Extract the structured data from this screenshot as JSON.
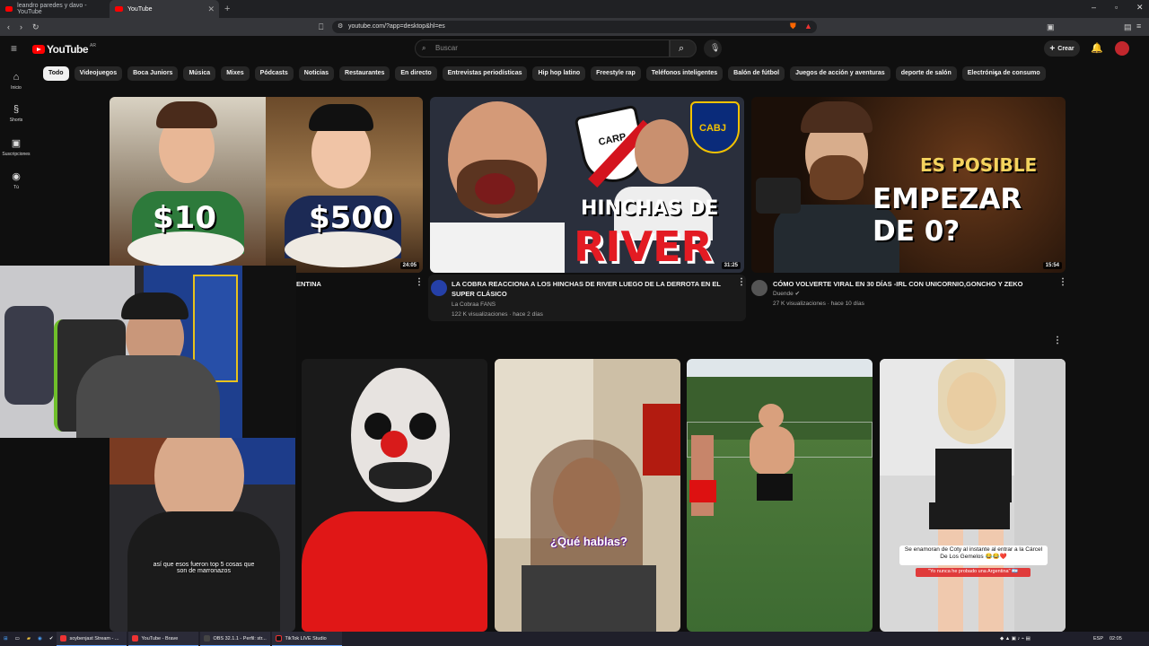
{
  "browser": {
    "tabs": [
      {
        "title": "leandro paredes y davo - YouTube"
      },
      {
        "title": "YouTube"
      }
    ],
    "url": "youtube.com/?app=desktop&hl=es"
  },
  "header": {
    "logo_text": "YouTube",
    "region": "AR",
    "search_placeholder": "Buscar",
    "create_label": "Crear"
  },
  "sidebar": {
    "items": [
      {
        "label": "Inicio",
        "icon": "home-icon"
      },
      {
        "label": "Shorts",
        "icon": "shorts-icon"
      },
      {
        "label": "Suscripciones",
        "icon": "subscriptions-icon"
      },
      {
        "label": "Tú",
        "icon": "you-icon"
      }
    ]
  },
  "chips": [
    "Todo",
    "Videojuegos",
    "Boca Juniors",
    "Música",
    "Mixes",
    "Pódcasts",
    "Noticias",
    "Restaurantes",
    "En directo",
    "Entrevistas periodísticas",
    "Hip hop latino",
    "Freestyle rap",
    "Teléfonos inteligentes",
    "Balón de fútbol",
    "Juegos de acción y aventuras",
    "deporte de salón",
    "Electrónica de consumo"
  ],
  "videos": [
    {
      "title": "ENTINA",
      "thumb_texts": [
        "$10",
        "$500"
      ],
      "duration": "24:05"
    },
    {
      "title": "LA COBRA REACCIONA A LOS HINCHAS DE RIVER LUEGO DE LA DERROTA EN EL SUPER CLÁSICO",
      "channel": "La Cobraa FANS",
      "meta": "122 K visualizaciones · hace 2 días",
      "thumb_texts": [
        "HINCHAS DE",
        "RIVER",
        "CABJ",
        "CARP"
      ],
      "duration": "31:25"
    },
    {
      "title": "CÓMO VOLVERTE VIRAL EN 30 DÍAS -IRL CON UNICORNIO,GONCHO Y ZEKO",
      "channel": "Duende",
      "meta": "27 K visualizaciones · hace 10 días",
      "thumb_texts": [
        "ES POSIBLE",
        "EMPEZAR DE 0?"
      ],
      "duration": "15:54"
    }
  ],
  "shorts": [
    {
      "caption": "así que esos fueron top 5 cosas que son de marronazos"
    },
    {
      "caption": ""
    },
    {
      "caption": "¿Qué hablas?"
    },
    {
      "caption": ""
    },
    {
      "caption": "Se enamoran de Coty al instante al entrar a la Cárcel De Los Gemelos 😂😂❤️",
      "subcaption": "\"Yo nunca he probado una Argentina\" 🇦🇷"
    }
  ],
  "taskbar": {
    "apps": [
      {
        "label": "soybenjast Stream - ..."
      },
      {
        "label": "YouTube - Brave"
      },
      {
        "label": "OBS 32.1.1 - Perfil: str..."
      },
      {
        "label": "TikTok LIVE Studio"
      }
    ],
    "lang": "ESP",
    "time": "02:05"
  }
}
